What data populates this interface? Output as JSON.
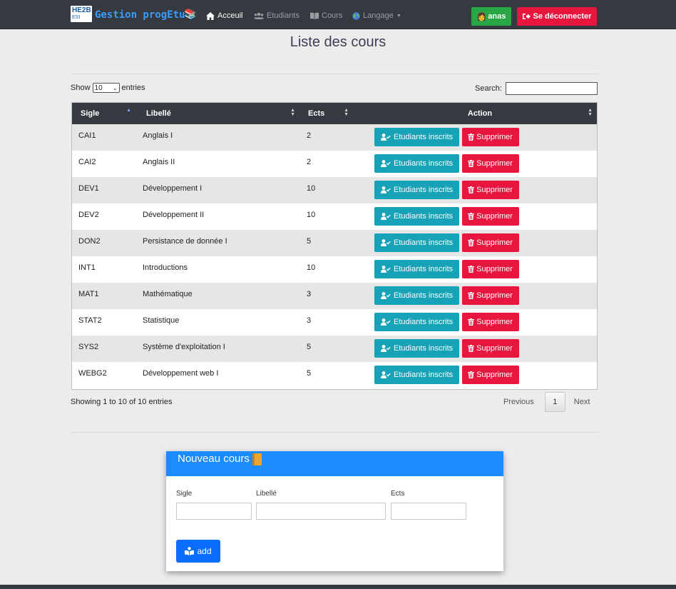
{
  "navbar": {
    "logo_line1": "HE2B",
    "logo_line2": "ESI",
    "brand": "Gestion progEtu",
    "items": [
      {
        "label": "Acceuil",
        "icon": "home-icon",
        "active": true
      },
      {
        "label": "Etudiants",
        "icon": "users-icon",
        "active": false
      },
      {
        "label": "Cours",
        "icon": "book-open-icon",
        "active": false
      },
      {
        "label": "Langage",
        "icon": "globe-icon",
        "active": false
      }
    ],
    "user_label": "anas",
    "logout_label": "Se déconnecter"
  },
  "page_title": "Liste des cours",
  "table_controls": {
    "show_label": "Show",
    "entries_label": "entries",
    "entries_value": "10",
    "search_label": "Search:",
    "search_value": ""
  },
  "table": {
    "columns": [
      "Sigle",
      "Libellé",
      "Ects",
      "Action"
    ],
    "rows": [
      {
        "sigle": "CAI1",
        "libelle": "Anglais I",
        "ects": "2"
      },
      {
        "sigle": "CAI2",
        "libelle": "Anglais II",
        "ects": "2"
      },
      {
        "sigle": "DEV1",
        "libelle": "Développement I",
        "ects": "10"
      },
      {
        "sigle": "DEV2",
        "libelle": "Développement II",
        "ects": "10"
      },
      {
        "sigle": "DON2",
        "libelle": "Persistance de donnée I",
        "ects": "5"
      },
      {
        "sigle": "INT1",
        "libelle": "Introductions",
        "ects": "10"
      },
      {
        "sigle": "MAT1",
        "libelle": "Mathématique",
        "ects": "3"
      },
      {
        "sigle": "STAT2",
        "libelle": "Statistique",
        "ects": "3"
      },
      {
        "sigle": "SYS2",
        "libelle": "Système d'exploitation I",
        "ects": "5"
      },
      {
        "sigle": "WEBG2",
        "libelle": "Développement web I",
        "ects": "5"
      }
    ],
    "inscrits_label": "Etudiants inscrits",
    "delete_label": "Supprimer"
  },
  "footer_info": "Showing 1 to 10 of 10 entries",
  "pagination": {
    "previous": "Previous",
    "current": "1",
    "next": "Next"
  },
  "new_course": {
    "title": "Nouveau cours",
    "sigle_label": "Sigle",
    "libelle_label": "Libellé",
    "ects_label": "Ects",
    "add_label": "add"
  },
  "colors": {
    "navbar": "#343a40",
    "brand": "#3b9cff",
    "info_button": "#17a2b8",
    "danger_button": "#e8153f",
    "success_button": "#28a745",
    "card_header": "#1a8cff",
    "primary_button": "#0b6dfd"
  }
}
